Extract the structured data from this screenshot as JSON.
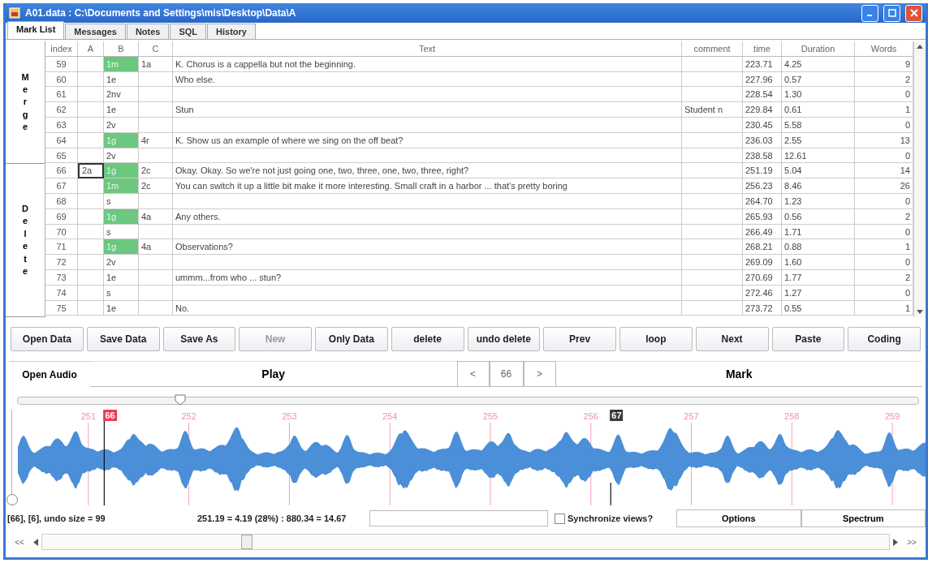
{
  "window": {
    "title": "A01.data : C:\\Documents and Settings\\mis\\Desktop\\Data\\A"
  },
  "tabs": [
    {
      "label": "Mark List",
      "selected": true
    },
    {
      "label": "Messages",
      "selected": false
    },
    {
      "label": "Notes",
      "selected": false
    },
    {
      "label": "SQL",
      "selected": false
    },
    {
      "label": "History",
      "selected": false
    }
  ],
  "side_buttons": [
    {
      "label": "Merge"
    },
    {
      "label": "Delete"
    }
  ],
  "table": {
    "columns": [
      "index",
      "A",
      "B",
      "C",
      "Text",
      "comment",
      "time",
      "Duration",
      "Words"
    ],
    "rows": [
      {
        "index": "59",
        "b": "1m",
        "highlighted": true,
        "c": "1a",
        "text": "K. Chorus is a cappella but not the beginning.",
        "time": "223.71",
        "duration": "4.25",
        "words": "9",
        "editing": false
      },
      {
        "index": "60",
        "b": "1e",
        "highlighted": false,
        "text": "Who else.",
        "time": "227.96",
        "duration": "0.57",
        "words": "2",
        "editing": false
      },
      {
        "index": "61",
        "b": "2nv",
        "highlighted": false,
        "time": "228.54",
        "duration": "1.30",
        "words": "0",
        "editing": false
      },
      {
        "index": "62",
        "b": "1e",
        "highlighted": false,
        "text": "Stun",
        "comment": "Student n",
        "time": "229.84",
        "duration": "0.61",
        "words": "1",
        "editing": false
      },
      {
        "index": "63",
        "b": "2v",
        "highlighted": false,
        "time": "230.45",
        "duration": "5.58",
        "words": "0",
        "editing": false
      },
      {
        "index": "64",
        "b": "1g",
        "highlighted": true,
        "c": "4r",
        "text": "K. Show us an example of where we sing on the off beat?",
        "time": "236.03",
        "duration": "2.55",
        "words": "13",
        "editing": false
      },
      {
        "index": "65",
        "b": "2v",
        "highlighted": false,
        "time": "238.58",
        "duration": "12.61",
        "words": "0",
        "editing": false
      },
      {
        "index": "66",
        "a": "2a",
        "b": "1g",
        "highlighted": true,
        "c": "2c",
        "text": "Okay. Okay. So we're not just going one, two, three, one, two, three, right?",
        "time": "251.19",
        "duration": "5.04",
        "words": "14",
        "editing": true
      },
      {
        "index": "67",
        "b": "1m",
        "highlighted": true,
        "c": "2c",
        "text": "You can switch it up a little bit make it more interesting. Small craft in a harbor ... that's pretty boring",
        "time": "256.23",
        "duration": "8.46",
        "words": "26",
        "editing": false
      },
      {
        "index": "68",
        "b": "s",
        "highlighted": false,
        "time": "264.70",
        "duration": "1.23",
        "words": "0",
        "editing": false
      },
      {
        "index": "69",
        "b": "1g",
        "highlighted": true,
        "c": "4a",
        "text": "Any others.",
        "time": "265.93",
        "duration": "0.56",
        "words": "2",
        "editing": false
      },
      {
        "index": "70",
        "b": "s",
        "highlighted": false,
        "time": "266.49",
        "duration": "1.71",
        "words": "0",
        "editing": false
      },
      {
        "index": "71",
        "b": "1g",
        "highlighted": true,
        "c": "4a",
        "text": "Observations?",
        "time": "268.21",
        "duration": "0.88",
        "words": "1",
        "editing": false
      },
      {
        "index": "72",
        "b": "2v",
        "highlighted": false,
        "time": "269.09",
        "duration": "1.60",
        "words": "0",
        "editing": false
      },
      {
        "index": "73",
        "b": "1e",
        "highlighted": false,
        "text": "ummm...from who ... stun?",
        "time": "270.69",
        "duration": "1.77",
        "words": "2",
        "editing": false
      },
      {
        "index": "74",
        "b": "s",
        "highlighted": false,
        "time": "272.46",
        "duration": "1.27",
        "words": "0",
        "editing": false
      },
      {
        "index": "75",
        "b": "1e",
        "highlighted": false,
        "text": "No.",
        "time": "273.72",
        "duration": "0.55",
        "words": "1",
        "editing": false
      }
    ]
  },
  "toolbar": [
    {
      "label": "Open Data",
      "disabled": false
    },
    {
      "label": "Save Data",
      "disabled": false
    },
    {
      "label": "Save As",
      "disabled": false
    },
    {
      "label": "New",
      "disabled": true
    },
    {
      "label": "Only Data",
      "disabled": false
    },
    {
      "label": "delete",
      "disabled": false
    },
    {
      "label": "undo delete",
      "disabled": false
    },
    {
      "label": "Prev",
      "disabled": false
    },
    {
      "label": "loop",
      "disabled": false
    },
    {
      "label": "Next",
      "disabled": false
    },
    {
      "label": "Paste",
      "disabled": false
    },
    {
      "label": "Coding",
      "disabled": false
    }
  ],
  "player": {
    "open_audio": "Open Audio",
    "play": "Play",
    "prev": "<",
    "current": "66",
    "next": ">",
    "mark": "Mark"
  },
  "position_slider": {
    "level": 0.18
  },
  "waveform": {
    "ticks": [
      "251",
      "252",
      "253",
      "254",
      "255",
      "256",
      "257",
      "258",
      "259"
    ],
    "markers": [
      {
        "label": "66",
        "color": "#e8404f"
      },
      {
        "label": "67",
        "color": "#3a3a3a"
      }
    ]
  },
  "gain_slider": {
    "level": 0
  },
  "status": {
    "info": "[66], [6], undo size = 99",
    "selection": "251.19 = 4.19 (28%) : 880.34 = 14.67",
    "sync": {
      "label": "Synchronize views?",
      "checked": false
    },
    "buttons": [
      "Options",
      "Spectrum"
    ]
  },
  "scroll": {
    "first": "<<",
    "last": ">>"
  }
}
